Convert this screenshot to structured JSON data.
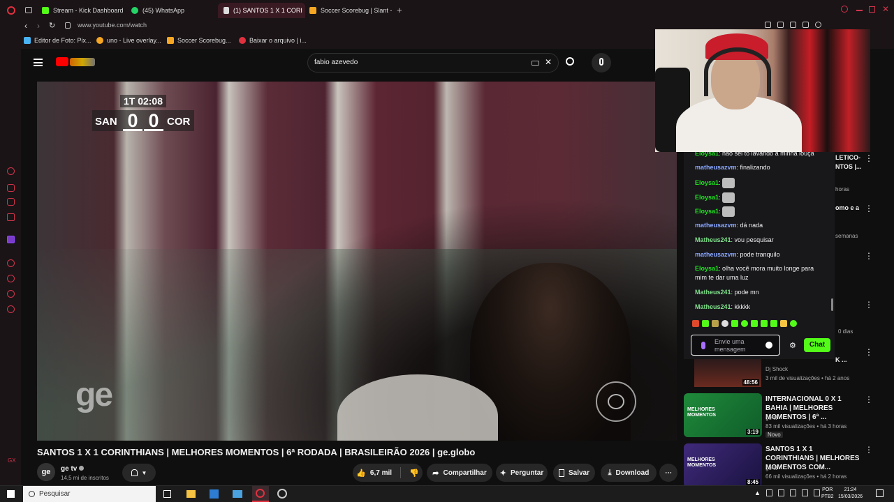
{
  "browser": {
    "tabs": [
      {
        "label": "Stream - Kick Dashboard",
        "color": "#53fc18"
      },
      {
        "label": "(45) WhatsApp",
        "color": "#25d366"
      },
      {
        "label": "(1) SANTOS 1 X 1 CORI",
        "color": "#ff0000",
        "active": true
      },
      {
        "label": "Soccer Scorebug | Slant -",
        "color": "#f5a623"
      }
    ],
    "url": "www.youtube.com/watch",
    "bookmarks": [
      {
        "label": "Editor de Foto: Pix..."
      },
      {
        "label": "uno - Live overlay..."
      },
      {
        "label": "Soccer Scorebug..."
      },
      {
        "label": "Baixar o arquivo | i..."
      }
    ]
  },
  "youtube": {
    "search_value": "fabio azevedo",
    "scorebug": {
      "time": "1T 02:08",
      "home": "SAN",
      "home_score": "0",
      "away_score": "0",
      "away": "COR"
    },
    "watermark": "ge",
    "video_title": "SANTOS 1 X 1 CORINTHIANS | MELHORES MOMENTOS | 6ª RODADA | BRASILEIRÃO 2026 | ge.globo",
    "channel": {
      "name": "ge tv",
      "subscribers": "14,5 mi de inscritos",
      "avatar": "ge"
    },
    "actions": {
      "likes": "6,7 mil",
      "share": "Compartilhar",
      "ask": "Perguntar",
      "save": "Salvar",
      "download": "Download"
    }
  },
  "chat": {
    "messages": [
      {
        "user": "Eloysa1",
        "text": "não sei to lavando a minha louça",
        "color": "#1ee61e"
      },
      {
        "user": "matheusazvm",
        "text": "finalizando",
        "color": "#8aa7ff"
      },
      {
        "user": "Eloysa1",
        "text": "",
        "color": "#1ee61e",
        "emote": true
      },
      {
        "user": "Eloysa1",
        "text": "",
        "color": "#1ee61e",
        "emote": true
      },
      {
        "user": "Eloysa1",
        "text": "",
        "color": "#1ee61e",
        "emote": true
      },
      {
        "user": "matheusazvm",
        "text": "dá nada",
        "color": "#8aa7ff"
      },
      {
        "user": "Matheus241",
        "text": "vou pesquisar",
        "color": "#7fe08a"
      },
      {
        "user": "matheusazvm",
        "text": "pode tranquilo",
        "color": "#8aa7ff"
      },
      {
        "user": "Eloysa1",
        "text": "olha você mora muito longe para mim te dar uma luz",
        "color": "#1ee61e"
      },
      {
        "user": "Matheus241",
        "text": "pode mn",
        "color": "#7fe08a"
      },
      {
        "user": "Matheus241",
        "text": "kkkkk",
        "color": "#7fe08a"
      }
    ],
    "input_placeholder": "Envie uma mensagem",
    "send_label": "Chat"
  },
  "sidebar_partial": {
    "item1_title": "LETICO-\nNTOS |...",
    "item1_meta": "horas",
    "item2_title": "omo e a",
    "item2_meta": "semanas",
    "item3_meta": "0 dias",
    "item4_title": "K ...",
    "item4_channel": "Dj Shock",
    "item4_meta": "3 mil de visualizações • há 2 anos",
    "item4_duration": "48:56"
  },
  "recommended": [
    {
      "title": "INTERNACIONAL 0 X 1 BAHIA | MELHORES MOMENTOS | 6ª ...",
      "channel": "ge tv",
      "meta": "83 mil visualizações • há 3 horas",
      "badge": "Novo",
      "duration": "3:19",
      "thumb_text": "MELHORES MOMENTOS"
    },
    {
      "title": "SANTOS 1 X 1 CORINTHIANS | MELHORES MOMENTOS COM...",
      "channel": "ge tv",
      "meta": "66 mil visualizações • há 2 horas",
      "duration": "8:45",
      "thumb_text": "MELHORES MOMENTOS"
    }
  ],
  "taskbar": {
    "search_label": "Pesquisar",
    "lang": "POR",
    "lang2": "PTB2",
    "time": "21:24",
    "date": "15/03/2026"
  }
}
